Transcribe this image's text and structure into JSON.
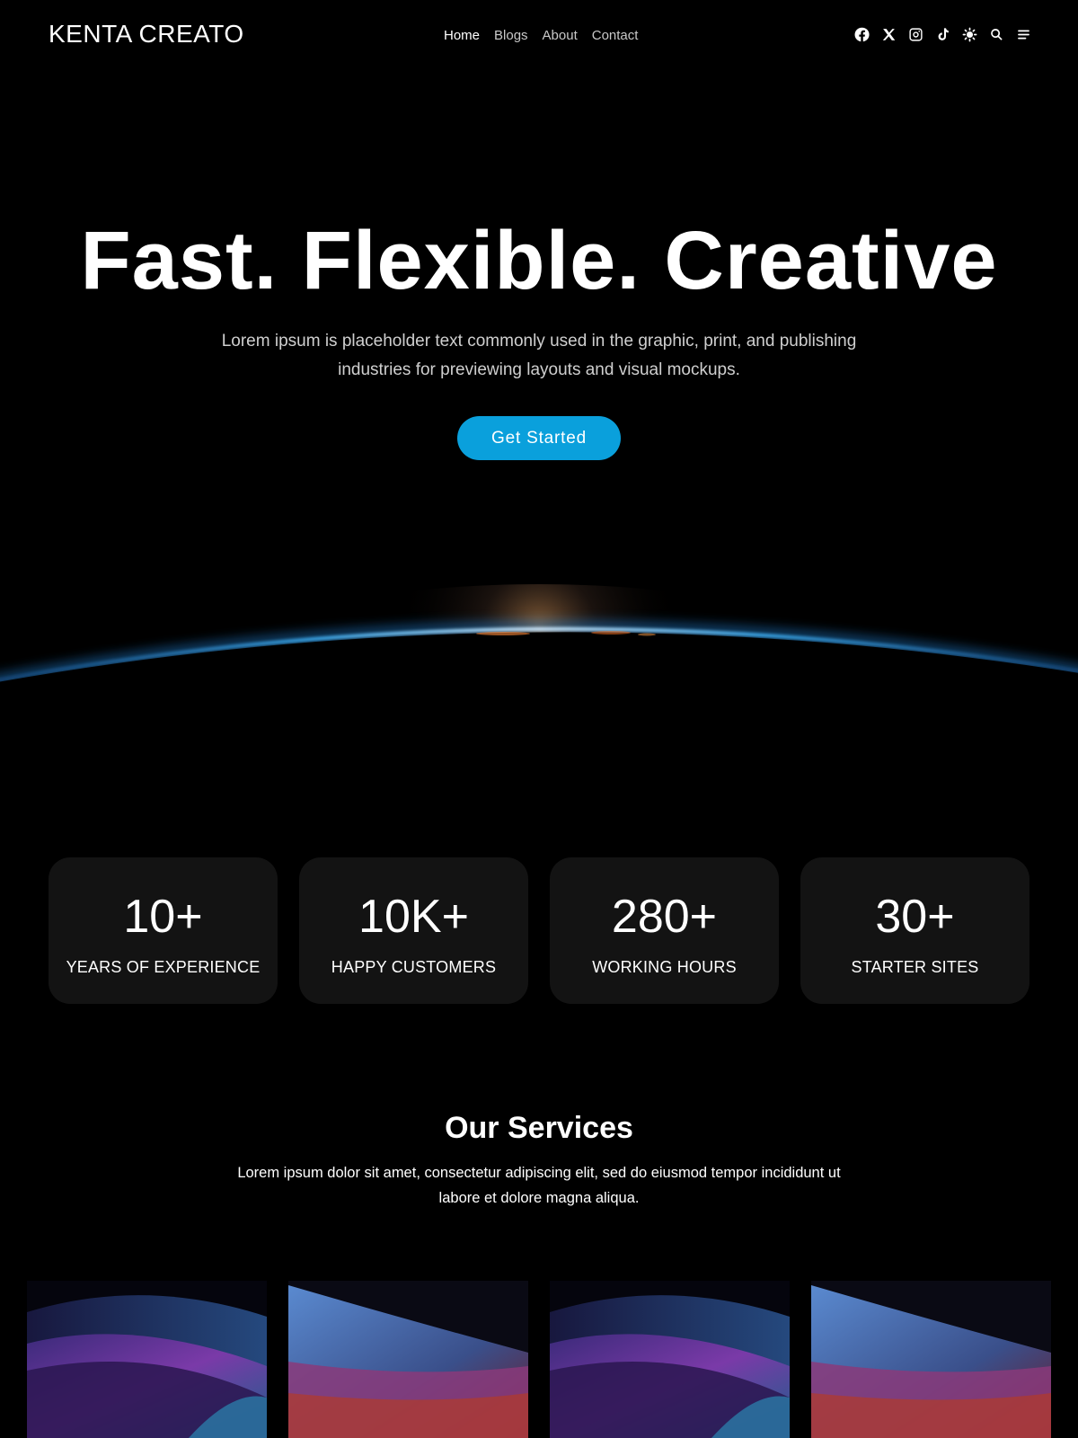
{
  "header": {
    "logo": "KENTA CREATO",
    "nav": [
      {
        "label": "Home",
        "active": true
      },
      {
        "label": "Blogs",
        "active": false
      },
      {
        "label": "About",
        "active": false
      },
      {
        "label": "Contact",
        "active": false
      }
    ],
    "icons": [
      "facebook-icon",
      "x-twitter-icon",
      "instagram-icon",
      "tiktok-icon",
      "theme-toggle-icon",
      "search-icon",
      "menu-icon"
    ]
  },
  "hero": {
    "title": "Fast. Flexible. Creative",
    "subtitle": "Lorem ipsum is placeholder text commonly used in the graphic, print, and publishing industries for previewing layouts and visual mockups.",
    "cta_label": "Get Started"
  },
  "stats": [
    {
      "value": "10+",
      "label": "YEARS OF EXPERIENCE"
    },
    {
      "value": "10K+",
      "label": "HAPPY CUSTOMERS"
    },
    {
      "value": "280+",
      "label": "WORKING HOURS"
    },
    {
      "value": "30+",
      "label": "STARTER SITES"
    }
  ],
  "services": {
    "title": "Our Services",
    "subtitle": "Lorem ipsum dolor sit amet, consectetur adipiscing elit, sed do eiusmod tempor incididunt ut labore et dolore magna aliqua."
  },
  "colors": {
    "background": "#000000",
    "accent": "#0aa0dc",
    "card": "#131313"
  }
}
